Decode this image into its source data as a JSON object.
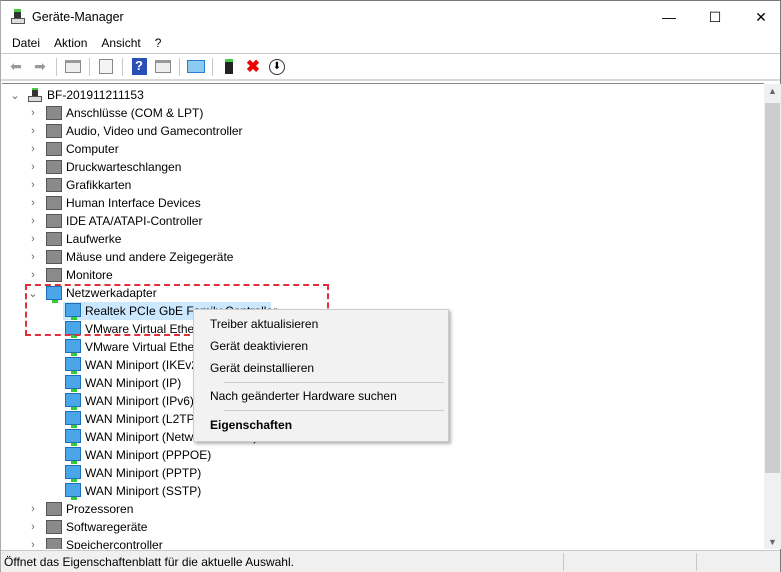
{
  "window": {
    "title": "Geräte-Manager",
    "minimize": "—",
    "maximize": "☐",
    "close": "✕"
  },
  "menu": [
    "Datei",
    "Aktion",
    "Ansicht",
    "?"
  ],
  "toolbar": [
    "back",
    "forward",
    "show-hide-console-tree",
    "properties",
    "help",
    "show-action-pane",
    "scan-hardware",
    "update-driver",
    "uninstall",
    "disable"
  ],
  "tree": {
    "root": "BF-201911211153",
    "categories_before": [
      "Anschlüsse (COM & LPT)",
      "Audio, Video und Gamecontroller",
      "Computer",
      "Druckwarteschlangen",
      "Grafikkarten",
      "Human Interface Devices",
      "IDE ATA/ATAPI-Controller",
      "Laufwerke",
      "Mäuse und andere Zeigegeräte",
      "Monitore"
    ],
    "expanded": "Netzwerkadapter",
    "adapters": [
      "Realtek PCIe GbE Family Controller",
      "VMware Virtual Ethernet Adapter for VMnet1",
      "VMware Virtual Ethernet Adapter for VMnet8",
      "WAN Miniport (IKEv2)",
      "WAN Miniport (IP)",
      "WAN Miniport (IPv6)",
      "WAN Miniport (L2TP)",
      "WAN Miniport (Network Monitor)",
      "WAN Miniport (PPPOE)",
      "WAN Miniport (PPTP)",
      "WAN Miniport (SSTP)"
    ],
    "categories_after": [
      "Prozessoren",
      "Softwaregeräte",
      "Speichercontroller"
    ]
  },
  "context_menu": {
    "update": "Treiber aktualisieren",
    "disable": "Gerät deaktivieren",
    "uninstall": "Gerät deinstallieren",
    "scan": "Nach geänderter Hardware suchen",
    "properties": "Eigenschaften"
  },
  "status": "Öffnet das Eigenschaftenblatt für die aktuelle Auswahl.",
  "colors": {
    "highlight": "#cce8ff",
    "dash": "#e0303a"
  }
}
